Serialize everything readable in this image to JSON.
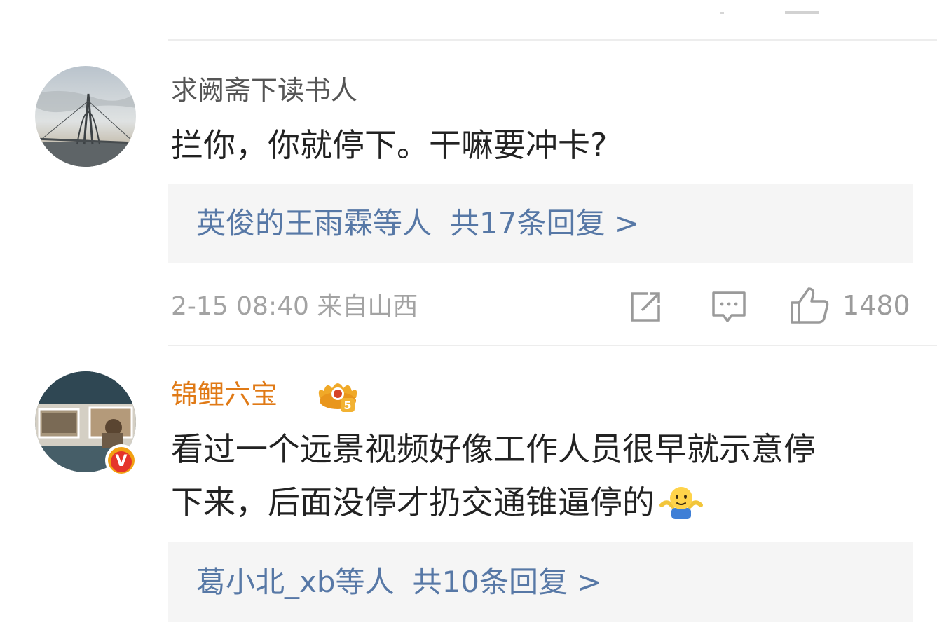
{
  "comments": [
    {
      "username": "求阙斋下读书人",
      "text_lines": [
        "拦你，你就停下。干嘛要冲卡?"
      ],
      "replies": {
        "names": "英俊的王雨霖等人",
        "count_text": "共17条回复 >"
      },
      "timestamp": "2-15 08:40 来自山西",
      "likes": "1480",
      "avatar": "avatar-bridge-photo"
    },
    {
      "username": "锦鲤六宝",
      "badge_icon": "crown-level-5-icon",
      "verified_icon": "orange-v-verified-icon",
      "text_lines": [
        "看过一个远景视频好像工作人员很早就示意停",
        "下来，后面没停才扔交通锥逼停的"
      ],
      "emoji": "shrug-emoji-icon",
      "replies": {
        "names": "葛小北_xb等人",
        "count_text": "共10条回复 >"
      },
      "avatar": "avatar-gallery-photo"
    }
  ],
  "colors": {
    "username_gray": "#555555",
    "username_gold": "#e07a16",
    "link_blue": "#5778a6",
    "meta_gray": "#a3a3a3",
    "reply_bg": "#f5f5f5"
  },
  "icons": [
    "share-icon",
    "comment-icon",
    "like-icon"
  ]
}
